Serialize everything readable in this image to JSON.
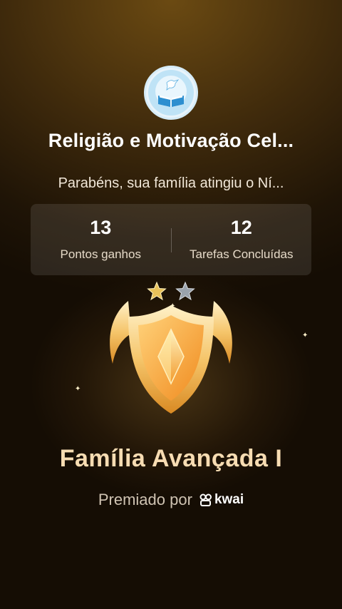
{
  "family": {
    "avatar_icon": "book-dove-icon",
    "name": "Religião e Motivação Cel...",
    "message": "Parabéns, sua família atingiu o Ní..."
  },
  "stats": [
    {
      "value": "13",
      "label": "Pontos ganhos"
    },
    {
      "value": "12",
      "label": "Tarefas Concluídas"
    }
  ],
  "badge": {
    "stars_filled": 1,
    "stars_total": 2,
    "level_name": "Família Avançada I",
    "colors": {
      "gold": "#f5b544",
      "star_gold": "#e9c25a",
      "star_silver": "#9aa3ad"
    }
  },
  "award": {
    "prefix": "Premiado por",
    "brand": "kwai",
    "brand_icon": "kwai-logo-icon"
  }
}
